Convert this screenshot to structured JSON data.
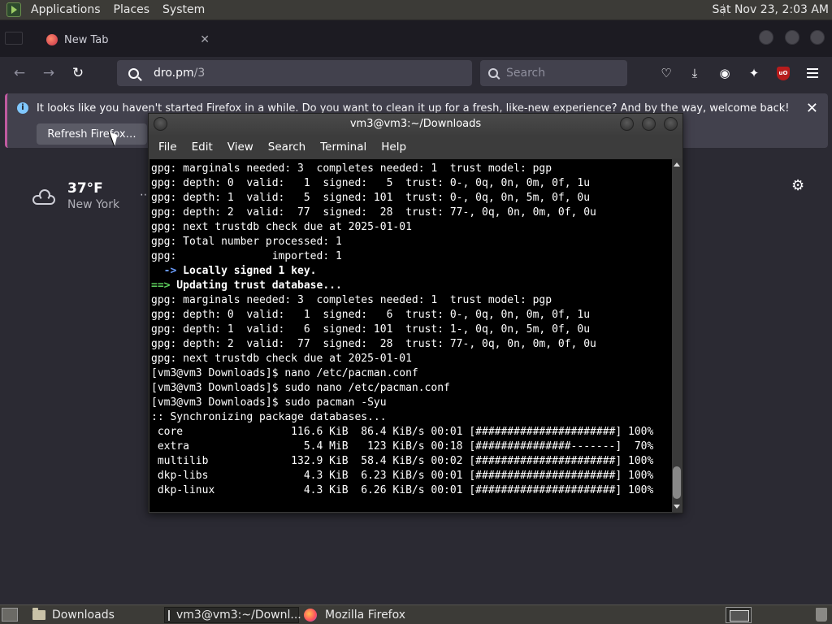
{
  "top_panel": {
    "menus": [
      "Applications",
      "Places",
      "System"
    ],
    "clock": "Sat Nov 23,  2:03 AM"
  },
  "firefox": {
    "tab_title": "New Tab",
    "url_host": "dro.pm",
    "url_path": "/3",
    "search_placeholder": "Search",
    "notification": {
      "message": "It looks like you haven't started Firefox in a while. Do you want to clean it up for a fresh, like-new experience? And by the way, welcome back!",
      "button": "Refresh Firefox…"
    },
    "weather": {
      "temperature": "37°F",
      "city": "New York",
      "more": "⋯"
    }
  },
  "terminal": {
    "title": "vm3@vm3:~/Downloads",
    "menu": [
      "File",
      "Edit",
      "View",
      "Search",
      "Terminal",
      "Help"
    ],
    "lines": [
      {
        "text": "gpg: marginals needed: 3  completes needed: 1  trust model: pgp",
        "style": ""
      },
      {
        "text": "gpg: depth: 0  valid:   1  signed:   5  trust: 0-, 0q, 0n, 0m, 0f, 1u",
        "style": ""
      },
      {
        "text": "gpg: depth: 1  valid:   5  signed: 101  trust: 0-, 0q, 0n, 5m, 0f, 0u",
        "style": ""
      },
      {
        "text": "gpg: depth: 2  valid:  77  signed:  28  trust: 77-, 0q, 0n, 0m, 0f, 0u",
        "style": ""
      },
      {
        "text": "gpg: next trustdb check due at 2025-01-01",
        "style": ""
      },
      {
        "text": "gpg: Total number processed: 1",
        "style": ""
      },
      {
        "text": "gpg:               imported: 1",
        "style": ""
      },
      {
        "text": "  -> Locally signed 1 key.",
        "style": "arrow"
      },
      {
        "text": "==> Updating trust database...",
        "style": "green"
      },
      {
        "text": "gpg: marginals needed: 3  completes needed: 1  trust model: pgp",
        "style": ""
      },
      {
        "text": "gpg: depth: 0  valid:   1  signed:   6  trust: 0-, 0q, 0n, 0m, 0f, 1u",
        "style": ""
      },
      {
        "text": "gpg: depth: 1  valid:   6  signed: 101  trust: 1-, 0q, 0n, 5m, 0f, 0u",
        "style": ""
      },
      {
        "text": "gpg: depth: 2  valid:  77  signed:  28  trust: 77-, 0q, 0n, 0m, 0f, 0u",
        "style": ""
      },
      {
        "text": "gpg: next trustdb check due at 2025-01-01",
        "style": ""
      },
      {
        "text": "[vm3@vm3 Downloads]$ nano /etc/pacman.conf",
        "style": ""
      },
      {
        "text": "[vm3@vm3 Downloads]$ sudo nano /etc/pacman.conf",
        "style": ""
      },
      {
        "text": "[vm3@vm3 Downloads]$ sudo pacman -Syu",
        "style": ""
      },
      {
        "text": ":: Synchronizing package databases...",
        "style": ""
      },
      {
        "text": " core                 116.6 KiB  86.4 KiB/s 00:01 [######################] 100%",
        "style": ""
      },
      {
        "text": " extra                  5.4 MiB   123 KiB/s 00:18 [###############-------]  70%",
        "style": ""
      },
      {
        "text": " multilib             132.9 KiB  58.4 KiB/s 00:02 [######################] 100%",
        "style": ""
      },
      {
        "text": " dkp-libs               4.3 KiB  6.23 KiB/s 00:01 [######################] 100%",
        "style": ""
      },
      {
        "text": " dkp-linux              4.3 KiB  6.26 KiB/s 00:01 [######################] 100%",
        "style": ""
      }
    ]
  },
  "taskbar": {
    "items": [
      "Downloads",
      "vm3@vm3:~/Downl...",
      "Mozilla Firefox"
    ]
  }
}
